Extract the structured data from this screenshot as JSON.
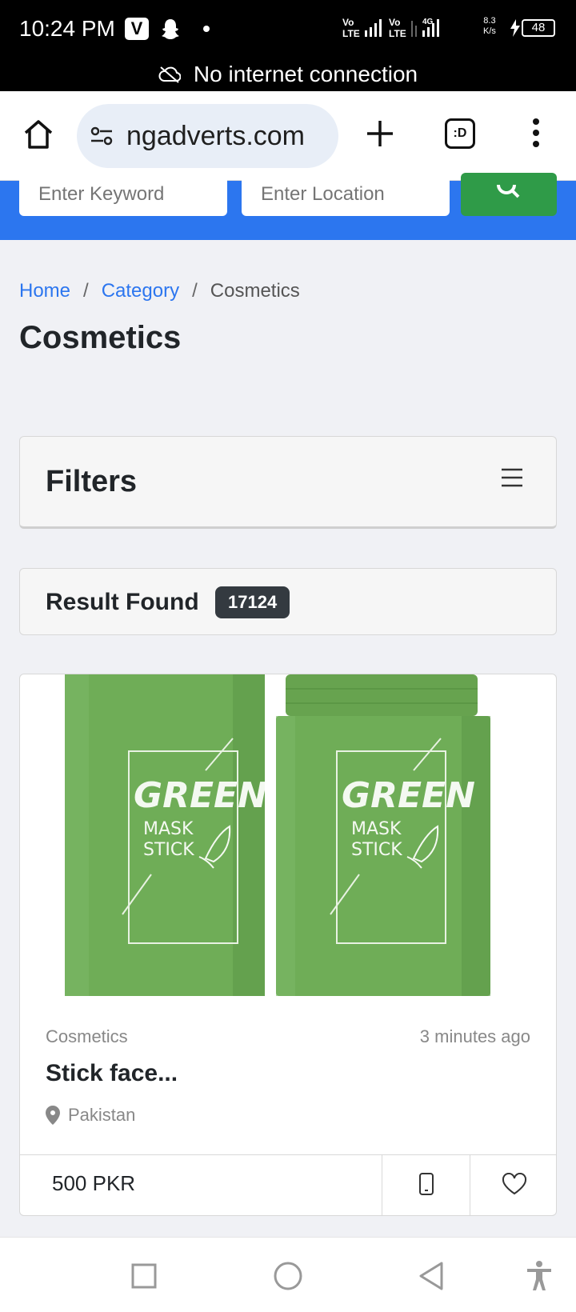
{
  "status_bar": {
    "time": "10:24 PM",
    "app_badge": "V",
    "network_speed": "8.3",
    "network_speed_unit": "K/s",
    "battery": "48"
  },
  "offline_banner": {
    "text": "No internet connection"
  },
  "browser": {
    "url": "ngadverts.com",
    "tab_switcher_label": ":D"
  },
  "search": {
    "keyword_placeholder": "Enter Keyword",
    "location_placeholder": "Enter Location"
  },
  "breadcrumb": {
    "home": "Home",
    "category": "Category",
    "current": "Cosmetics",
    "separator": "/"
  },
  "page_title": "Cosmetics",
  "filters": {
    "title": "Filters"
  },
  "results": {
    "label": "Result Found",
    "count": "17124"
  },
  "listing": {
    "category": "Cosmetics",
    "posted": "3 minutes ago",
    "title": "Stick face...",
    "location": "Pakistan",
    "price": "500 PKR",
    "image_text": {
      "brand": "GREEN",
      "line1": "MASK",
      "line2": "STICK"
    }
  },
  "colors": {
    "accent_blue": "#2c76ef",
    "search_green": "#2f9b48",
    "badge_dark": "#343a40",
    "product_green": "#6fad57"
  },
  "icons": {
    "browser": [
      "home-icon",
      "site-settings-icon",
      "new-tab-icon",
      "tab-switcher-icon",
      "more-menu-icon"
    ],
    "nav": [
      "recent-apps-icon",
      "home-button-icon",
      "back-icon",
      "accessibility-icon"
    ]
  }
}
